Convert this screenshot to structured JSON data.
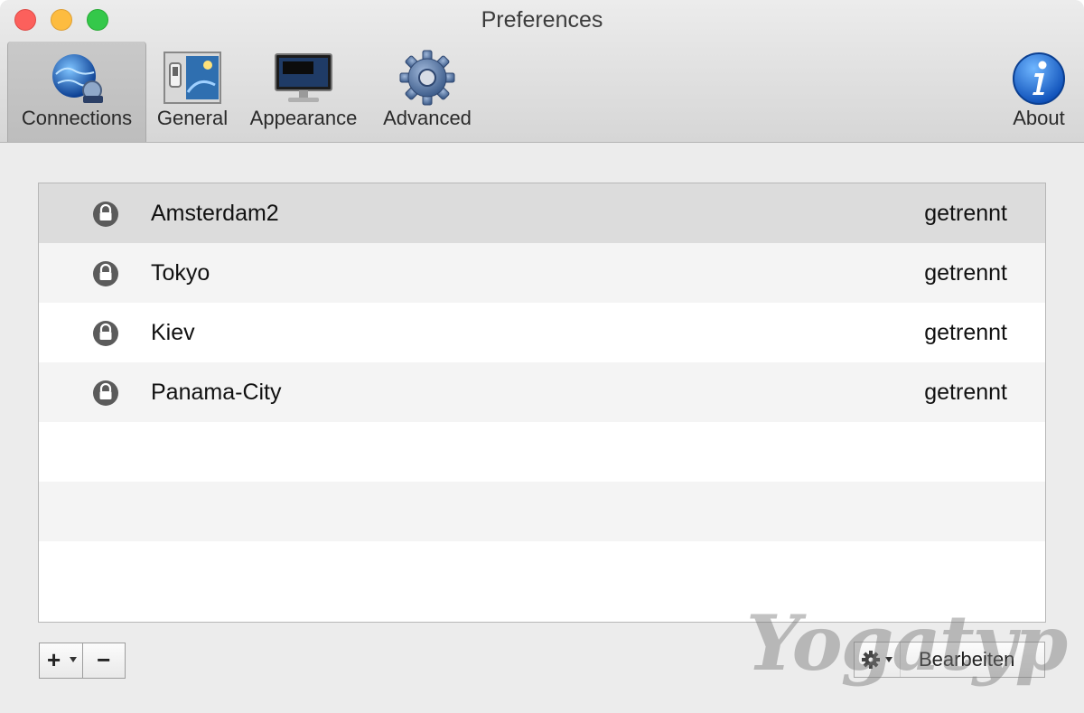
{
  "window": {
    "title": "Preferences"
  },
  "toolbar": {
    "items": [
      {
        "label": "Connections",
        "icon": "globe-network-icon",
        "selected": true
      },
      {
        "label": "General",
        "icon": "switch-panel-icon",
        "selected": false
      },
      {
        "label": "Appearance",
        "icon": "monitor-icon",
        "selected": false
      },
      {
        "label": "Advanced",
        "icon": "gear-icon",
        "selected": false
      },
      {
        "label": "About",
        "icon": "info-icon",
        "selected": false
      }
    ]
  },
  "connections": {
    "rows": [
      {
        "name": "Amsterdam2",
        "status": "getrennt",
        "selected": true
      },
      {
        "name": "Tokyo",
        "status": "getrennt",
        "selected": false
      },
      {
        "name": "Kiev",
        "status": "getrennt",
        "selected": false
      },
      {
        "name": "Panama-City",
        "status": "getrennt",
        "selected": false
      }
    ]
  },
  "bottom_bar": {
    "add_symbol": "+",
    "remove_symbol": "−",
    "edit_label": "Bearbeiten"
  },
  "watermark": {
    "text": "Yogatyp"
  },
  "colors": {
    "close": "#fc605c",
    "minimize": "#fdbc40",
    "zoom": "#34c84a",
    "selected_row": "#dcdcdc",
    "info_blue": "#1a6fd6"
  }
}
